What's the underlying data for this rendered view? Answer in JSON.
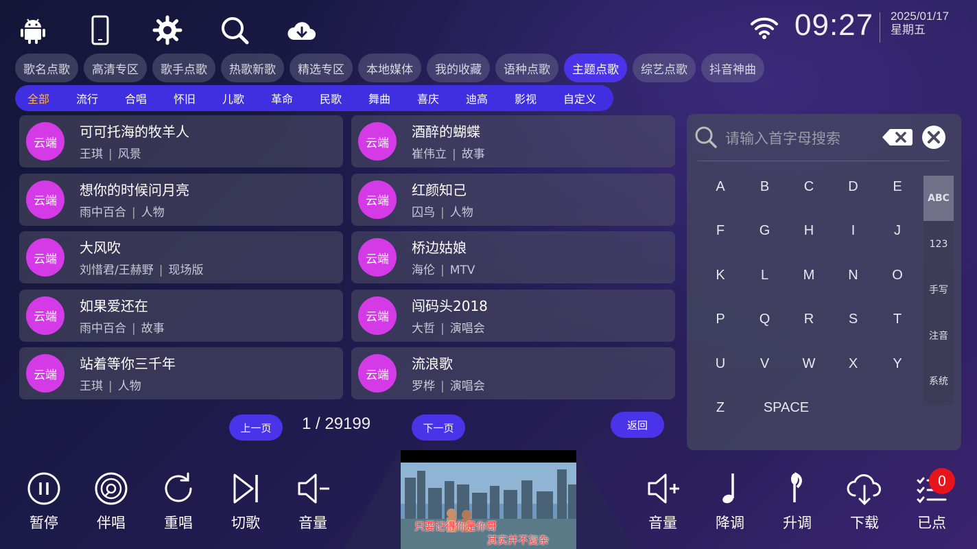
{
  "top_icons": [
    "android-icon",
    "phone-icon",
    "settings-icon",
    "search-icon",
    "cloud-download-icon"
  ],
  "status": {
    "time": "09:27",
    "date": "2025/01/17",
    "weekday": "星期五",
    "wifi": "wifi-icon"
  },
  "tabs": [
    {
      "label": "歌名点歌",
      "active": false
    },
    {
      "label": "高清专区",
      "active": false
    },
    {
      "label": "歌手点歌",
      "active": false
    },
    {
      "label": "热歌新歌",
      "active": false
    },
    {
      "label": "精选专区",
      "active": false
    },
    {
      "label": "本地媒体",
      "active": false
    },
    {
      "label": "我的收藏",
      "active": false
    },
    {
      "label": "语种点歌",
      "active": false
    },
    {
      "label": "主题点歌",
      "active": true
    },
    {
      "label": "综艺点歌",
      "active": false
    },
    {
      "label": "抖音神曲",
      "active": false
    }
  ],
  "subtabs": [
    {
      "label": "全部",
      "active": true
    },
    {
      "label": "流行",
      "active": false
    },
    {
      "label": "合唱",
      "active": false
    },
    {
      "label": "怀旧",
      "active": false
    },
    {
      "label": "儿歌",
      "active": false
    },
    {
      "label": "革命",
      "active": false
    },
    {
      "label": "民歌",
      "active": false
    },
    {
      "label": "舞曲",
      "active": false
    },
    {
      "label": "喜庆",
      "active": false
    },
    {
      "label": "迪高",
      "active": false
    },
    {
      "label": "影视",
      "active": false
    },
    {
      "label": "自定义",
      "active": false
    }
  ],
  "songs": [
    {
      "badge": "云端",
      "title": "可可托海的牧羊人",
      "artist": "王琪",
      "tag": "风景"
    },
    {
      "badge": "云端",
      "title": "酒醉的蝴蝶",
      "artist": "崔伟立",
      "tag": "故事"
    },
    {
      "badge": "云端",
      "title": "想你的时候问月亮",
      "artist": "雨中百合",
      "tag": "人物"
    },
    {
      "badge": "云端",
      "title": "红颜知己",
      "artist": "囚鸟",
      "tag": "人物"
    },
    {
      "badge": "云端",
      "title": "大风吹",
      "artist": "刘惜君/王赫野",
      "tag": "现场版"
    },
    {
      "badge": "云端",
      "title": "桥边姑娘",
      "artist": "海伦",
      "tag": "MTV"
    },
    {
      "badge": "云端",
      "title": "如果爱还在",
      "artist": "雨中百合",
      "tag": "故事"
    },
    {
      "badge": "云端",
      "title": "闯码头2018",
      "artist": "大哲",
      "tag": "演唱会"
    },
    {
      "badge": "云端",
      "title": "站着等你三千年",
      "artist": "王琪",
      "tag": "人物"
    },
    {
      "badge": "云端",
      "title": "流浪歌",
      "artist": "罗桦",
      "tag": "演唱会"
    }
  ],
  "separator": "|",
  "pagination": {
    "prev": "上一页",
    "next": "下一页",
    "info": "1 / 29199",
    "back": "返回"
  },
  "keyboard": {
    "placeholder": "请输入首字母搜索",
    "keys": [
      "A",
      "B",
      "C",
      "D",
      "E",
      "F",
      "G",
      "H",
      "I",
      "J",
      "K",
      "L",
      "M",
      "N",
      "O",
      "P",
      "Q",
      "R",
      "S",
      "T",
      "U",
      "V",
      "W",
      "X",
      "Y",
      "Z"
    ],
    "space": "SPACE",
    "modes": [
      {
        "label": "ABC",
        "active": true
      },
      {
        "label": "123",
        "active": false
      },
      {
        "label": "手写",
        "active": false
      },
      {
        "label": "注音",
        "active": false
      },
      {
        "label": "系统",
        "active": false
      }
    ]
  },
  "controls_left": [
    {
      "icon": "pause-icon",
      "label": "暂停"
    },
    {
      "icon": "accompany-icon",
      "label": "伴唱"
    },
    {
      "icon": "replay-icon",
      "label": "重唱"
    },
    {
      "icon": "skip-icon",
      "label": "切歌"
    },
    {
      "icon": "volume-down-icon",
      "label": "音量"
    }
  ],
  "controls_right": [
    {
      "icon": "volume-up-icon",
      "label": "音量"
    },
    {
      "icon": "pitch-down-icon",
      "label": "降调"
    },
    {
      "icon": "pitch-up-icon",
      "label": "升调"
    },
    {
      "icon": "download-icon",
      "label": "下载"
    },
    {
      "icon": "queue-icon",
      "label": "已点"
    }
  ],
  "queue_count": "0",
  "video": {
    "subtitle_line1": "只要记得你是你哥",
    "subtitle_line2": "其实并不复杂"
  }
}
